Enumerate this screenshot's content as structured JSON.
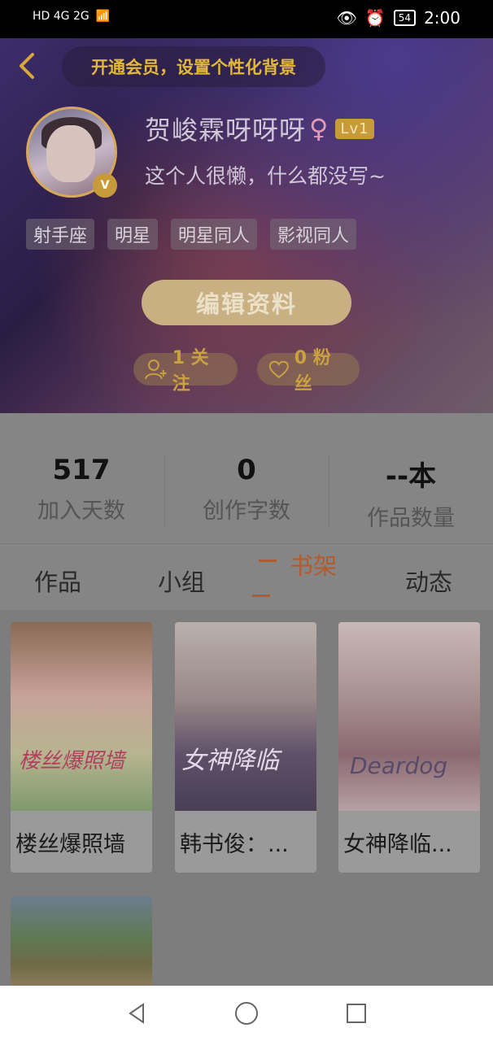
{
  "status_bar": {
    "network_left": "HD 4G 2G",
    "battery": "54",
    "time": "2:00"
  },
  "header": {
    "vip_text": "开通会员，设置个性化背景",
    "username": "贺峻霖呀呀呀",
    "gender_symbol": "♀",
    "level": "Lv1",
    "vip_badge": "V",
    "bio": "这个人很懒，什么都没写~",
    "tags": [
      "射手座",
      "明星",
      "明星同人",
      "影视同人"
    ],
    "edit_button": "编辑资料",
    "following": "1 关注",
    "fans": "0 粉丝"
  },
  "stats": [
    {
      "value": "517",
      "label": "加入天数"
    },
    {
      "value": "0",
      "label": "创作字数"
    },
    {
      "value": "--本",
      "label": "作品数量"
    }
  ],
  "tabs": [
    {
      "label": "作品",
      "active": false
    },
    {
      "label": "小组",
      "active": false
    },
    {
      "label": "书架",
      "active": true
    },
    {
      "label": "动态",
      "active": false
    }
  ],
  "books": [
    {
      "title": "楼丝爆照墙",
      "cover_text": "楼丝爆照墙"
    },
    {
      "title": "韩书俊：...",
      "cover_text": "女神降临"
    },
    {
      "title": "女神降临...",
      "cover_text": "Deardog"
    },
    {
      "title": "",
      "cover_text": ""
    }
  ],
  "colors": {
    "accent_gold": "#c9a042",
    "active_tab": "#b55a2b"
  }
}
